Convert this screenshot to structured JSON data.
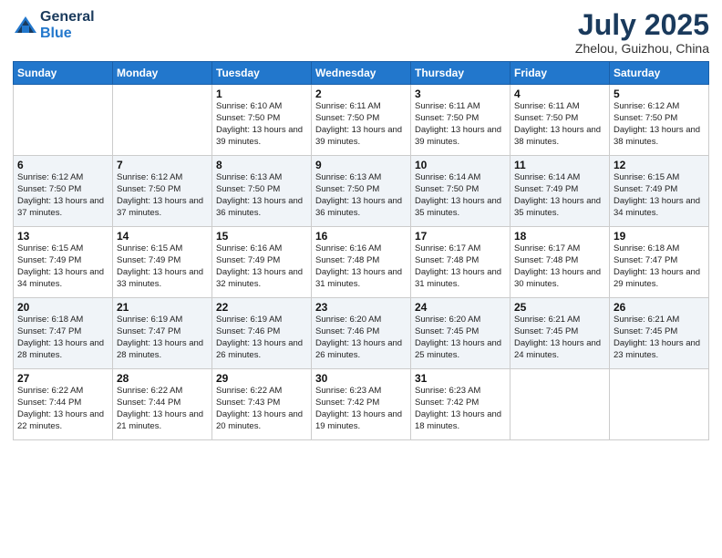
{
  "header": {
    "logo_general": "General",
    "logo_blue": "Blue",
    "month_title": "July 2025",
    "location": "Zhelou, Guizhou, China"
  },
  "days_of_week": [
    "Sunday",
    "Monday",
    "Tuesday",
    "Wednesday",
    "Thursday",
    "Friday",
    "Saturday"
  ],
  "weeks": [
    [
      {
        "day": "",
        "info": ""
      },
      {
        "day": "",
        "info": ""
      },
      {
        "day": "1",
        "info": "Sunrise: 6:10 AM\nSunset: 7:50 PM\nDaylight: 13 hours and 39 minutes."
      },
      {
        "day": "2",
        "info": "Sunrise: 6:11 AM\nSunset: 7:50 PM\nDaylight: 13 hours and 39 minutes."
      },
      {
        "day": "3",
        "info": "Sunrise: 6:11 AM\nSunset: 7:50 PM\nDaylight: 13 hours and 39 minutes."
      },
      {
        "day": "4",
        "info": "Sunrise: 6:11 AM\nSunset: 7:50 PM\nDaylight: 13 hours and 38 minutes."
      },
      {
        "day": "5",
        "info": "Sunrise: 6:12 AM\nSunset: 7:50 PM\nDaylight: 13 hours and 38 minutes."
      }
    ],
    [
      {
        "day": "6",
        "info": "Sunrise: 6:12 AM\nSunset: 7:50 PM\nDaylight: 13 hours and 37 minutes."
      },
      {
        "day": "7",
        "info": "Sunrise: 6:12 AM\nSunset: 7:50 PM\nDaylight: 13 hours and 37 minutes."
      },
      {
        "day": "8",
        "info": "Sunrise: 6:13 AM\nSunset: 7:50 PM\nDaylight: 13 hours and 36 minutes."
      },
      {
        "day": "9",
        "info": "Sunrise: 6:13 AM\nSunset: 7:50 PM\nDaylight: 13 hours and 36 minutes."
      },
      {
        "day": "10",
        "info": "Sunrise: 6:14 AM\nSunset: 7:50 PM\nDaylight: 13 hours and 35 minutes."
      },
      {
        "day": "11",
        "info": "Sunrise: 6:14 AM\nSunset: 7:49 PM\nDaylight: 13 hours and 35 minutes."
      },
      {
        "day": "12",
        "info": "Sunrise: 6:15 AM\nSunset: 7:49 PM\nDaylight: 13 hours and 34 minutes."
      }
    ],
    [
      {
        "day": "13",
        "info": "Sunrise: 6:15 AM\nSunset: 7:49 PM\nDaylight: 13 hours and 34 minutes."
      },
      {
        "day": "14",
        "info": "Sunrise: 6:15 AM\nSunset: 7:49 PM\nDaylight: 13 hours and 33 minutes."
      },
      {
        "day": "15",
        "info": "Sunrise: 6:16 AM\nSunset: 7:49 PM\nDaylight: 13 hours and 32 minutes."
      },
      {
        "day": "16",
        "info": "Sunrise: 6:16 AM\nSunset: 7:48 PM\nDaylight: 13 hours and 31 minutes."
      },
      {
        "day": "17",
        "info": "Sunrise: 6:17 AM\nSunset: 7:48 PM\nDaylight: 13 hours and 31 minutes."
      },
      {
        "day": "18",
        "info": "Sunrise: 6:17 AM\nSunset: 7:48 PM\nDaylight: 13 hours and 30 minutes."
      },
      {
        "day": "19",
        "info": "Sunrise: 6:18 AM\nSunset: 7:47 PM\nDaylight: 13 hours and 29 minutes."
      }
    ],
    [
      {
        "day": "20",
        "info": "Sunrise: 6:18 AM\nSunset: 7:47 PM\nDaylight: 13 hours and 28 minutes."
      },
      {
        "day": "21",
        "info": "Sunrise: 6:19 AM\nSunset: 7:47 PM\nDaylight: 13 hours and 28 minutes."
      },
      {
        "day": "22",
        "info": "Sunrise: 6:19 AM\nSunset: 7:46 PM\nDaylight: 13 hours and 26 minutes."
      },
      {
        "day": "23",
        "info": "Sunrise: 6:20 AM\nSunset: 7:46 PM\nDaylight: 13 hours and 26 minutes."
      },
      {
        "day": "24",
        "info": "Sunrise: 6:20 AM\nSunset: 7:45 PM\nDaylight: 13 hours and 25 minutes."
      },
      {
        "day": "25",
        "info": "Sunrise: 6:21 AM\nSunset: 7:45 PM\nDaylight: 13 hours and 24 minutes."
      },
      {
        "day": "26",
        "info": "Sunrise: 6:21 AM\nSunset: 7:45 PM\nDaylight: 13 hours and 23 minutes."
      }
    ],
    [
      {
        "day": "27",
        "info": "Sunrise: 6:22 AM\nSunset: 7:44 PM\nDaylight: 13 hours and 22 minutes."
      },
      {
        "day": "28",
        "info": "Sunrise: 6:22 AM\nSunset: 7:44 PM\nDaylight: 13 hours and 21 minutes."
      },
      {
        "day": "29",
        "info": "Sunrise: 6:22 AM\nSunset: 7:43 PM\nDaylight: 13 hours and 20 minutes."
      },
      {
        "day": "30",
        "info": "Sunrise: 6:23 AM\nSunset: 7:42 PM\nDaylight: 13 hours and 19 minutes."
      },
      {
        "day": "31",
        "info": "Sunrise: 6:23 AM\nSunset: 7:42 PM\nDaylight: 13 hours and 18 minutes."
      },
      {
        "day": "",
        "info": ""
      },
      {
        "day": "",
        "info": ""
      }
    ]
  ]
}
